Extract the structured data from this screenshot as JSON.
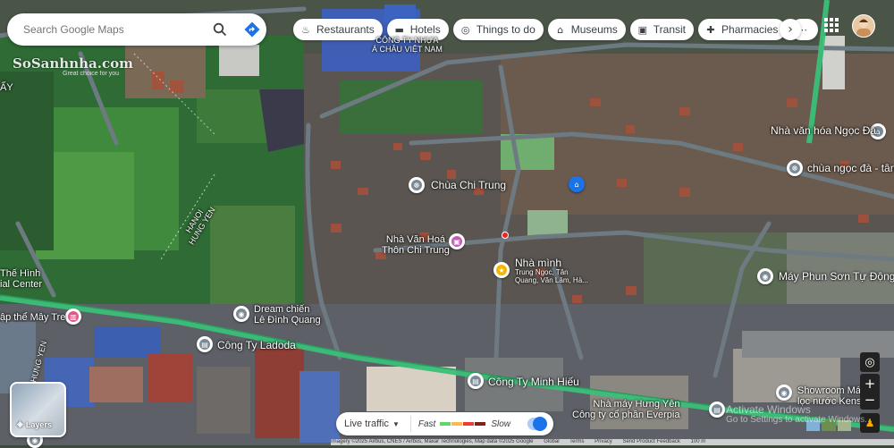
{
  "search": {
    "placeholder": "Search Google Maps"
  },
  "chips": [
    {
      "icon": "fork-knife-icon",
      "glyph": "♨",
      "label": "Restaurants"
    },
    {
      "icon": "bed-icon",
      "glyph": "▬",
      "label": "Hotels"
    },
    {
      "icon": "camera-icon",
      "glyph": "◎",
      "label": "Things to do"
    },
    {
      "icon": "museum-icon",
      "glyph": "⌂",
      "label": "Museums"
    },
    {
      "icon": "bus-icon",
      "glyph": "▣",
      "label": "Transit"
    },
    {
      "icon": "pharmacy-icon",
      "glyph": "✚",
      "label": "Pharmacies"
    }
  ],
  "watermark": {
    "brand": "SoSanhnha.com",
    "tagline": "Great choice for you"
  },
  "places": [
    {
      "name": "Nhà văn hóa Ngọc Đà",
      "icon": "landmark-icon"
    },
    {
      "name": "chùa ngọc đà - tân c",
      "icon": "temple-icon"
    },
    {
      "name": "Chùa Chi Trung",
      "icon": "temple-icon"
    },
    {
      "name": "Nhà Văn Hoá\nThôn Chi Trung",
      "icon": "community-hall-icon"
    },
    {
      "name": "Nhà mình",
      "icon": "star-icon",
      "sub": "Trung Ngọc, Tân\nQuang, Văn Lâm, Hà..."
    },
    {
      "name": "Máy Phun Sơn Tự Động",
      "icon": "store-icon"
    },
    {
      "name": "Dream chiến\nLê Đình Quang",
      "icon": "store-icon"
    },
    {
      "name": "Công Ty Ladoda",
      "icon": "building-icon"
    },
    {
      "name": "Công Ty Minh Hiếu",
      "icon": "building-icon"
    },
    {
      "name": "Nhà máy Hưng Yên\nCông ty cổ phần Everpia",
      "icon": "building-icon"
    },
    {
      "name": "Showroom Má\nlọc nước Kensi",
      "icon": "store-icon"
    },
    {
      "name": "ập thể Mây Tre",
      "icon": "shopping-icon"
    },
    {
      "name": "CÔNG TY NHỰA\nÁ CHÂU VIỆT NAM",
      "icon": ""
    }
  ],
  "road_labels": [
    "HANOI\nHUNG YEN",
    "HUNG YEN",
    "ẤY"
  ],
  "edge_labels": [
    "Thế Hình",
    "ial Center"
  ],
  "layers": {
    "label": "Layers"
  },
  "traffic": {
    "label": "Live traffic",
    "fast": "Fast",
    "slow": "Slow",
    "colors": [
      "#63d668",
      "#ffb84d",
      "#f23c32",
      "#811f1f"
    ]
  },
  "footer": {
    "imagery": "Imagery ©2025 Airbus, CNES / Airbus, Maxar Technologies, Map data ©2025 Google",
    "links": [
      "Global",
      "Terms",
      "Privacy",
      "Send Product Feedback"
    ],
    "scale": "100 m"
  },
  "windows_watermark": {
    "line1": "Activate Windows",
    "line2": "Go to Settings to activate Windows."
  },
  "colors": {
    "road": "#6e7a82",
    "highway": "#3bbf78",
    "accent": "#1a73e8"
  }
}
